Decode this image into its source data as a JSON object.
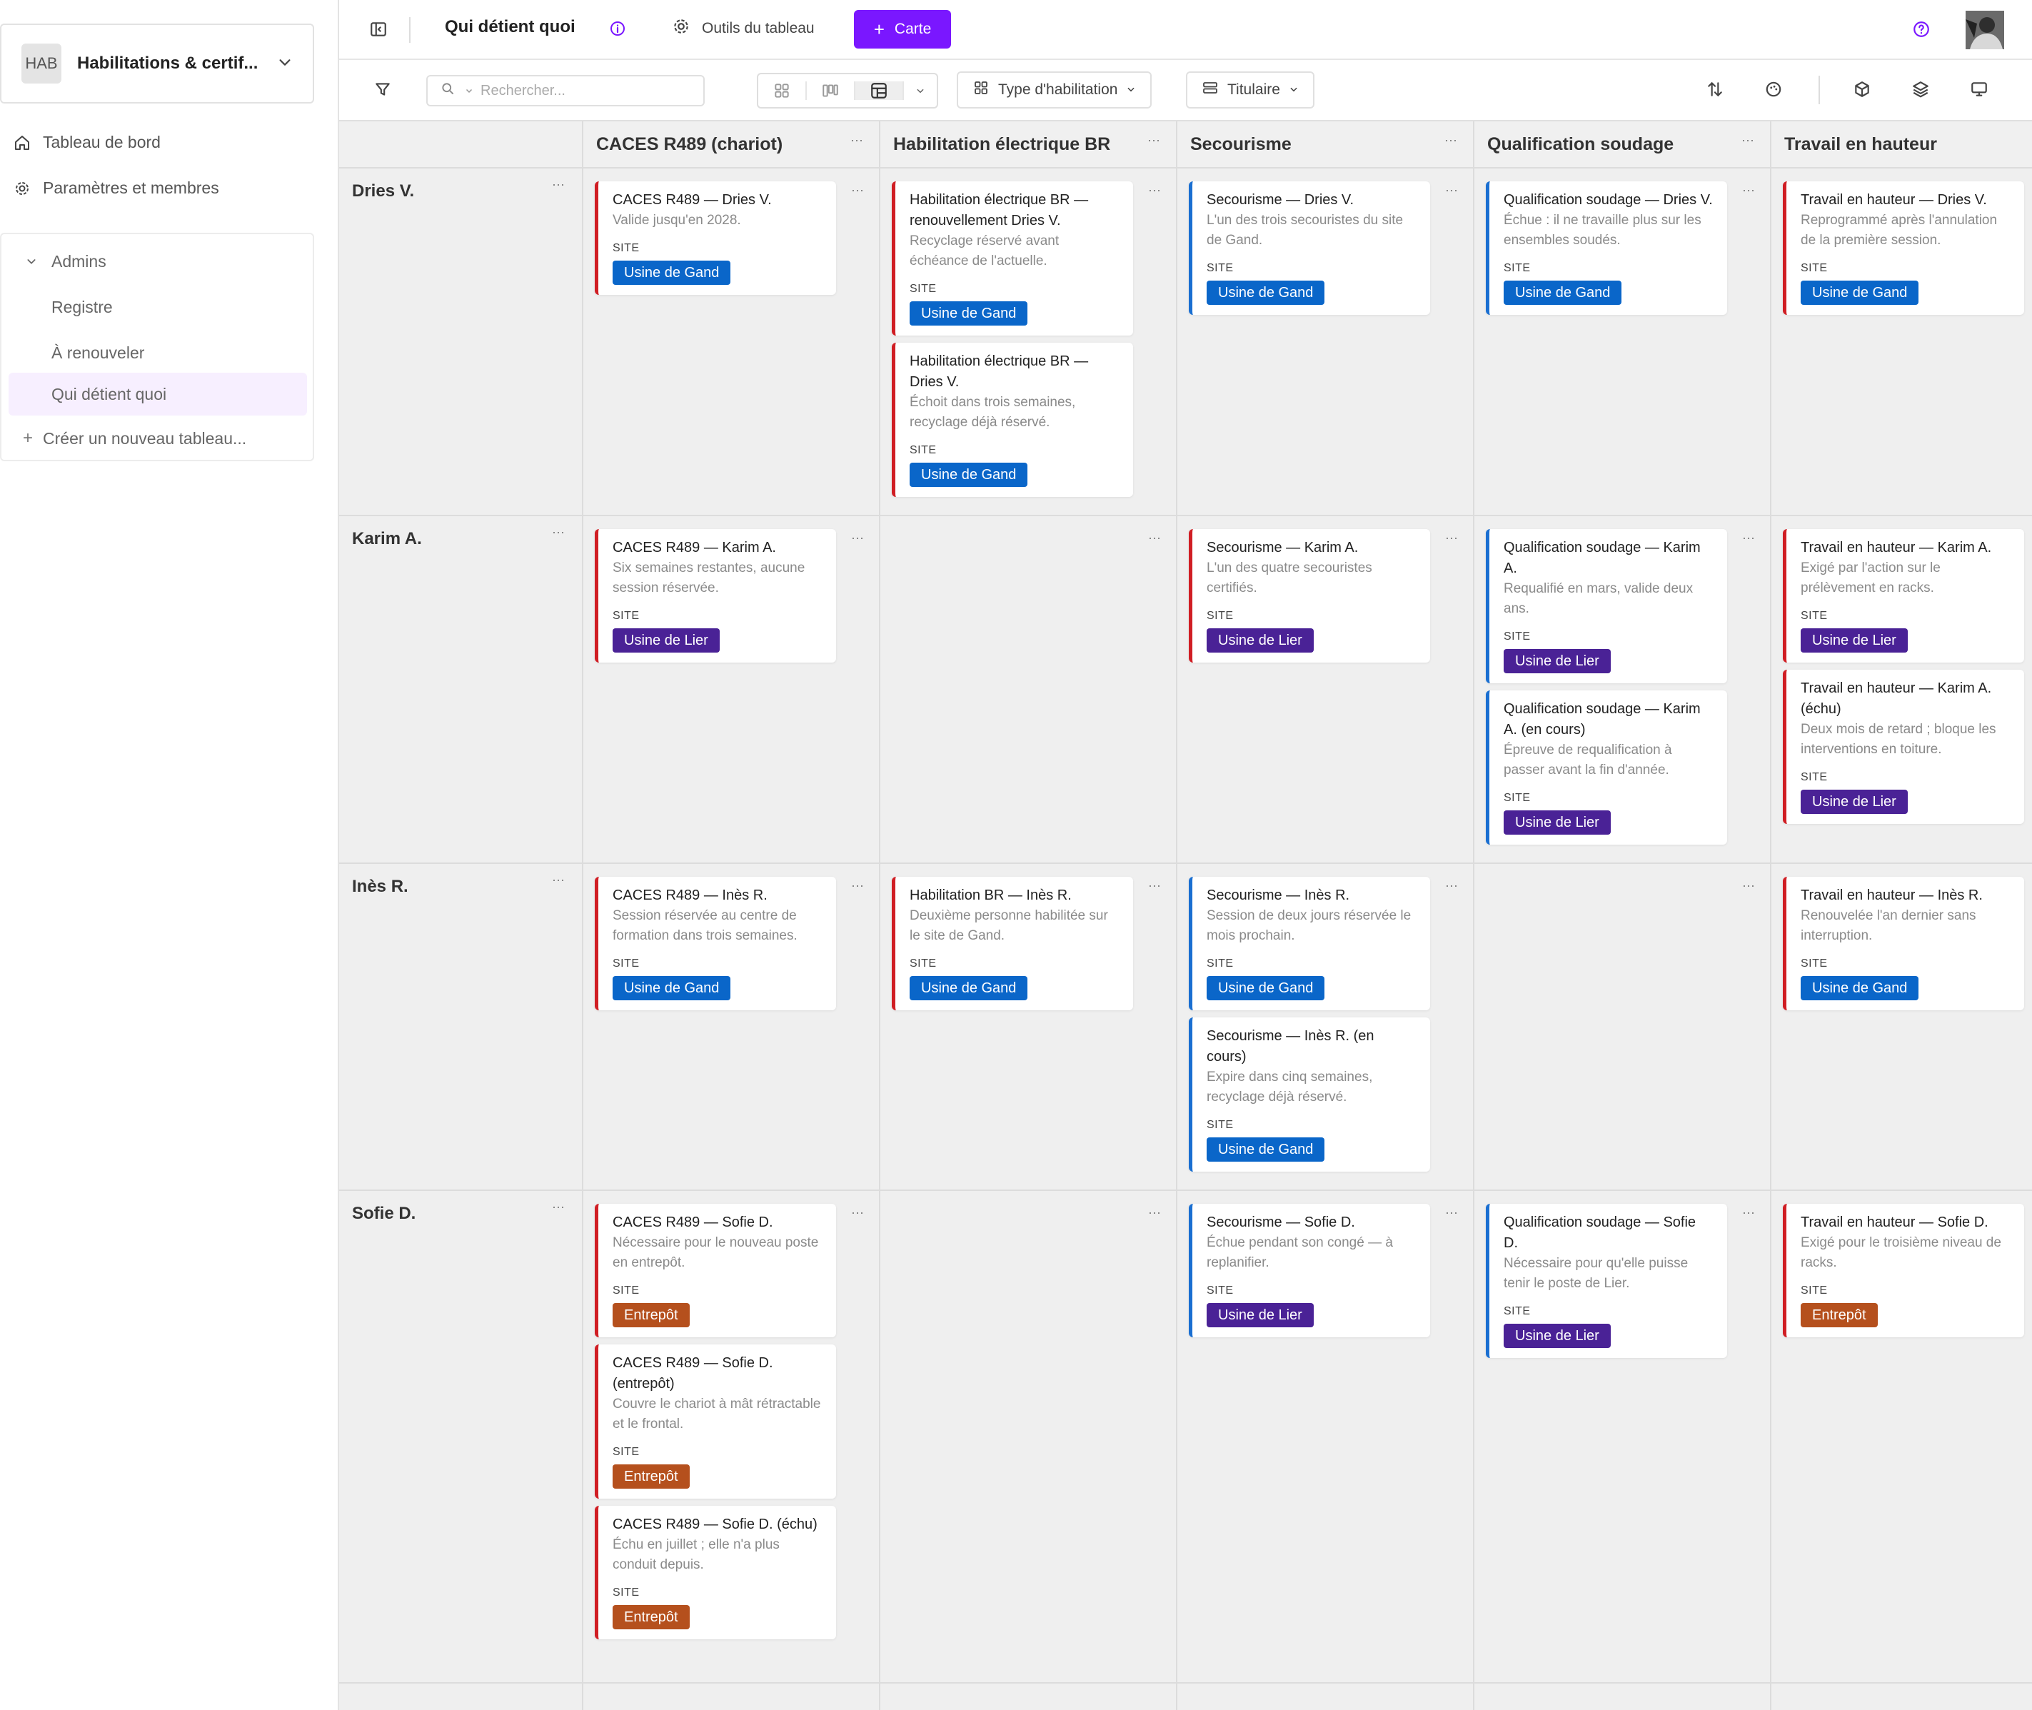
{
  "sidebar": {
    "workspace_abbr": "HAB",
    "workspace_name": "Habilitations & certif...",
    "nav": [
      {
        "label": "Tableau de bord",
        "icon": "home-icon"
      },
      {
        "label": "Paramètres et membres",
        "icon": "gear-icon"
      }
    ],
    "group_label": "Admins",
    "group_items": [
      "Registre",
      "À renouveler",
      "Qui détient quoi"
    ],
    "active_item": "Qui détient quoi",
    "create_label": "Créer un nouveau tableau..."
  },
  "topbar": {
    "board_title": "Qui détient quoi",
    "tools_label": "Outils du tableau",
    "add_card_label": "Carte"
  },
  "toolbar": {
    "search_placeholder": "Rechercher...",
    "group_by_columns": "Type d'habilitation",
    "group_by_rows": "Titulaire"
  },
  "colors": {
    "accent": "#7a17ff",
    "card_bar_red": "#d01e24",
    "card_bar_blue": "#1a6fd1",
    "tag_gand": "#0a66c9",
    "tag_lier": "#4a2296",
    "tag_entrepot": "#b5501d"
  },
  "board": {
    "columns": [
      "CACES R489 (chariot)",
      "Habilitation électrique BR",
      "Secourisme",
      "Qualification soudage",
      "Travail en hauteur"
    ],
    "rows": [
      "Dries V.",
      "Karim A.",
      "Inès R.",
      "Sofie D."
    ],
    "site_label": "SITE",
    "cards": [
      {
        "row": 0,
        "col": 0,
        "color": "red",
        "title": "CACES R489 — Dries V.",
        "desc": "Valide jusqu'en 2028.",
        "site": "Usine de Gand"
      },
      {
        "row": 0,
        "col": 1,
        "color": "red",
        "title": "Habilitation électrique BR — renouvellement Dries V.",
        "desc": "Recyclage réservé avant échéance de l'actuelle.",
        "site": "Usine de Gand"
      },
      {
        "row": 0,
        "col": 1,
        "color": "red",
        "title": "Habilitation électrique BR — Dries V.",
        "desc": "Échoit dans trois semaines, recyclage déjà réservé.",
        "site": "Usine de Gand"
      },
      {
        "row": 0,
        "col": 2,
        "color": "blue",
        "title": "Secourisme — Dries V.",
        "desc": "L'un des trois secouristes du site de Gand.",
        "site": "Usine de Gand"
      },
      {
        "row": 0,
        "col": 3,
        "color": "blue",
        "title": "Qualification soudage — Dries V.",
        "desc": "Échue : il ne travaille plus sur les ensembles soudés.",
        "site": "Usine de Gand"
      },
      {
        "row": 0,
        "col": 4,
        "color": "red",
        "title": "Travail en hauteur — Dries V.",
        "desc": "Reprogrammé après l'annulation de la première session.",
        "site": "Usine de Gand"
      },
      {
        "row": 1,
        "col": 0,
        "color": "red",
        "title": "CACES R489 — Karim A.",
        "desc": "Six semaines restantes, aucune session réservée.",
        "site": "Usine de Lier"
      },
      {
        "row": 1,
        "col": 2,
        "color": "red",
        "title": "Secourisme — Karim A.",
        "desc": "L'un des quatre secouristes certifiés.",
        "site": "Usine de Lier"
      },
      {
        "row": 1,
        "col": 3,
        "color": "blue",
        "title": "Qualification soudage — Karim A.",
        "desc": "Requalifié en mars, valide deux ans.",
        "site": "Usine de Lier"
      },
      {
        "row": 1,
        "col": 3,
        "color": "blue",
        "title": "Qualification soudage — Karim A. (en cours)",
        "desc": "Épreuve de requalification à passer avant la fin d'année.",
        "site": "Usine de Lier"
      },
      {
        "row": 1,
        "col": 4,
        "color": "red",
        "title": "Travail en hauteur — Karim A.",
        "desc": "Exigé par l'action sur le prélèvement en racks.",
        "site": "Usine de Lier"
      },
      {
        "row": 1,
        "col": 4,
        "color": "red",
        "title": "Travail en hauteur — Karim A. (échu)",
        "desc": "Deux mois de retard ; bloque les interventions en toiture.",
        "site": "Usine de Lier"
      },
      {
        "row": 2,
        "col": 0,
        "color": "red",
        "title": "CACES R489 — Inès R.",
        "desc": "Session réservée au centre de formation dans trois semaines.",
        "site": "Usine de Gand"
      },
      {
        "row": 2,
        "col": 1,
        "color": "red",
        "title": "Habilitation BR — Inès R.",
        "desc": "Deuxième personne habilitée sur le site de Gand.",
        "site": "Usine de Gand"
      },
      {
        "row": 2,
        "col": 2,
        "color": "blue",
        "title": "Secourisme — Inès R.",
        "desc": "Session de deux jours réservée le mois prochain.",
        "site": "Usine de Gand"
      },
      {
        "row": 2,
        "col": 2,
        "color": "blue",
        "title": "Secourisme — Inès R. (en cours)",
        "desc": "Expire dans cinq semaines, recyclage déjà réservé.",
        "site": "Usine de Gand"
      },
      {
        "row": 2,
        "col": 4,
        "color": "red",
        "title": "Travail en hauteur — Inès R.",
        "desc": "Renouvelée l'an dernier sans interruption.",
        "site": "Usine de Gand"
      },
      {
        "row": 3,
        "col": 0,
        "color": "red",
        "title": "CACES R489 — Sofie D.",
        "desc": "Nécessaire pour le nouveau poste en entrepôt.",
        "site": "Entrepôt"
      },
      {
        "row": 3,
        "col": 0,
        "color": "red",
        "title": "CACES R489 — Sofie D. (entrepôt)",
        "desc": "Couvre le chariot à mât rétractable et le frontal.",
        "site": "Entrepôt"
      },
      {
        "row": 3,
        "col": 0,
        "color": "red",
        "title": "CACES R489 — Sofie D. (échu)",
        "desc": "Échu en juillet ; elle n'a plus conduit depuis.",
        "site": "Entrepôt"
      },
      {
        "row": 3,
        "col": 2,
        "color": "blue",
        "title": "Secourisme — Sofie D.",
        "desc": "Échue pendant son congé — à replanifier.",
        "site": "Usine de Lier"
      },
      {
        "row": 3,
        "col": 3,
        "color": "blue",
        "title": "Qualification soudage — Sofie D.",
        "desc": "Nécessaire pour qu'elle puisse tenir le poste de Lier.",
        "site": "Usine de Lier"
      },
      {
        "row": 3,
        "col": 4,
        "color": "red",
        "title": "Travail en hauteur — Sofie D.",
        "desc": "Exigé pour le troisième niveau de racks.",
        "site": "Entrepôt"
      }
    ]
  }
}
